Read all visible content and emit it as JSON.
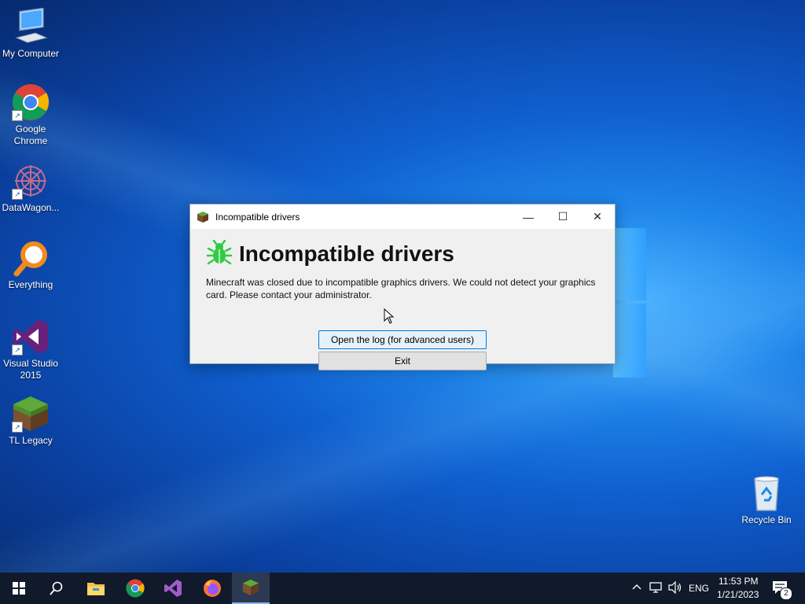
{
  "desktop": {
    "icons": [
      {
        "label": "My Computer"
      },
      {
        "label": "Google Chrome"
      },
      {
        "label": "DataWagon..."
      },
      {
        "label": "Everything"
      },
      {
        "label": "Visual Studio 2015"
      },
      {
        "label": "TL Legacy"
      },
      {
        "label": "Recycle Bin"
      }
    ]
  },
  "dialog": {
    "window_title": "Incompatible drivers",
    "heading": "Incompatible drivers",
    "message": "Minecraft was closed due to incompatible graphics drivers. We could not detect your graphics card. Please contact your administrator.",
    "open_log_label": "Open the log (for advanced users)",
    "exit_label": "Exit",
    "minimize_glyph": "—",
    "maximize_glyph": "☐",
    "close_glyph": "✕",
    "bug_color": "#2ecc40"
  },
  "taskbar": {
    "items": [
      "start-icon",
      "search-icon",
      "file-explorer-icon",
      "chrome-icon",
      "visual-studio-icon",
      "firefox-icon",
      "minecraft-icon"
    ],
    "language": "ENG",
    "time": "11:53 PM",
    "date": "1/21/2023",
    "notification_count": "2"
  }
}
